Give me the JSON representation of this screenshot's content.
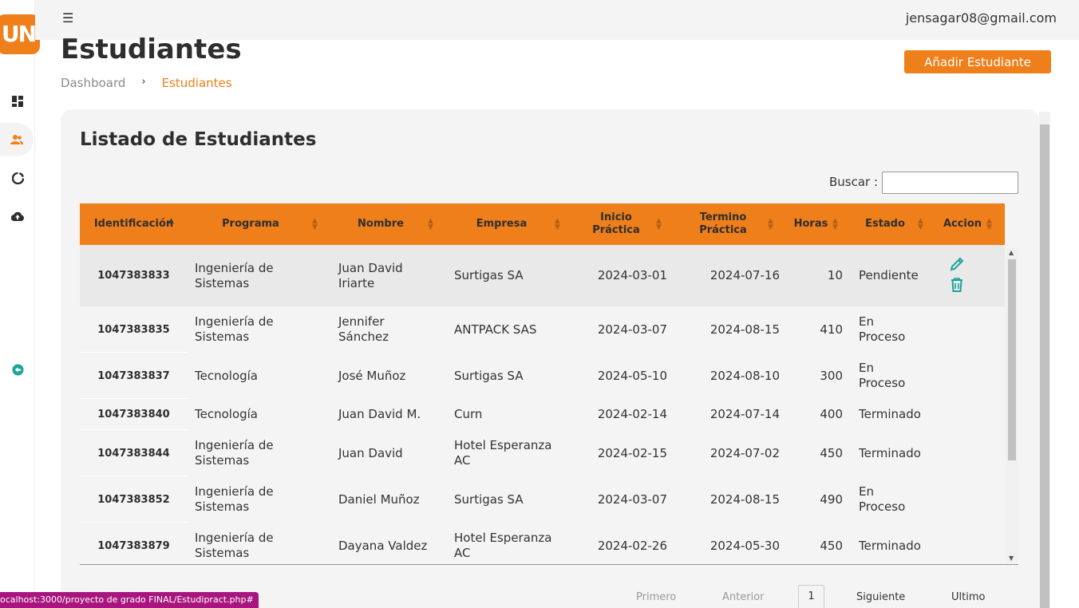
{
  "app": {
    "logo_text": "UN",
    "brand_color": "#ef7f1a"
  },
  "topbar": {
    "user_email": "jensagar08@gmail.com",
    "menu_icon": "hamburger-icon"
  },
  "sidebar": {
    "items": [
      {
        "name": "dashboard",
        "icon": "grid-icon"
      },
      {
        "name": "students",
        "icon": "users-icon",
        "active": true
      },
      {
        "name": "reports",
        "icon": "pie-chart-icon"
      },
      {
        "name": "upload",
        "icon": "cloud-upload-icon"
      },
      {
        "name": "logout",
        "icon": "arrow-left-circle-icon"
      }
    ]
  },
  "header": {
    "title": "Estudiantes",
    "breadcrumb": [
      "Dashboard",
      "Estudiantes"
    ],
    "breadcrumb_separator": "›",
    "add_button": "Añadir Estudiante"
  },
  "card": {
    "title": "Listado de Estudiantes",
    "search_label": "Buscar :",
    "search_value": ""
  },
  "table": {
    "columns": [
      "Identificación",
      "Programa",
      "Nombre",
      "Empresa",
      "Inicio Práctica",
      "Termino Práctica",
      "Horas",
      "Estado",
      "Accion"
    ],
    "rows": [
      [
        "1047383833",
        "Ingeniería de Sistemas",
        "Juan David Iriarte",
        "Surtigas SA",
        "2024-03-01",
        "2024-07-16",
        "10",
        "Pendiente"
      ],
      [
        "1047383835",
        "Ingeniería de Sistemas",
        "Jennifer Sánchez",
        "ANTPACK SAS",
        "2024-03-07",
        "2024-08-15",
        "410",
        "En Proceso"
      ],
      [
        "1047383837",
        "Tecnología",
        "José Muñoz",
        "Surtigas SA",
        "2024-05-10",
        "2024-08-10",
        "300",
        "En Proceso"
      ],
      [
        "1047383840",
        "Tecnología",
        "Juan David M.",
        "Curn",
        "2024-02-14",
        "2024-07-14",
        "400",
        "Terminado"
      ],
      [
        "1047383844",
        "Ingeniería de Sistemas",
        "Juan David",
        "Hotel Esperanza AC",
        "2024-02-15",
        "2024-07-02",
        "450",
        "Terminado"
      ],
      [
        "1047383852",
        "Ingeniería de Sistemas",
        "Daniel Muñoz",
        "Surtigas SA",
        "2024-03-07",
        "2024-08-15",
        "490",
        "En Proceso"
      ],
      [
        "1047383879",
        "Ingeniería de Sistemas",
        "Dayana Valdez",
        "Hotel Esperanza AC",
        "2024-02-26",
        "2024-05-30",
        "450",
        "Terminado"
      ]
    ],
    "action_icons": [
      "pencil-icon",
      "trash-icon"
    ],
    "action_color": "#1aa39a"
  },
  "pagination": {
    "first": "Primero",
    "previous": "Anterior",
    "current": "1",
    "next": "Siguiente",
    "last": "Ultimo"
  },
  "status_bar": {
    "url": "ocalhost:3000/proyecto de grado FINAL/Estudipract.php#"
  }
}
